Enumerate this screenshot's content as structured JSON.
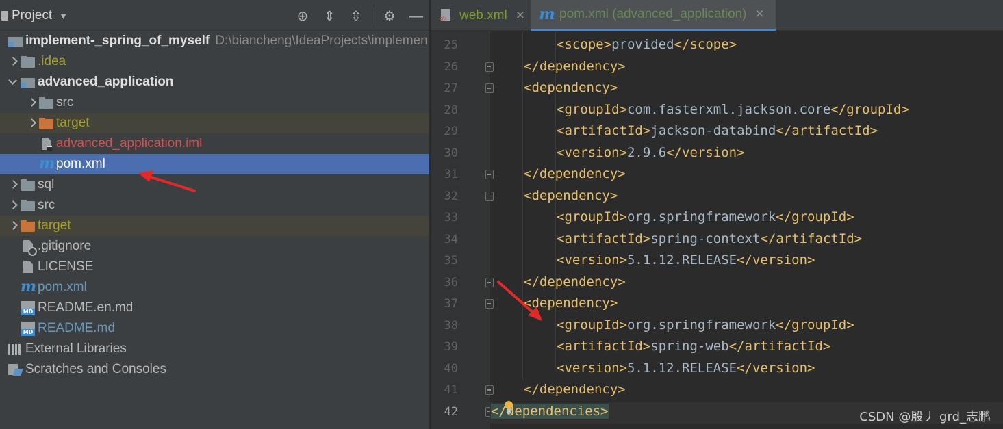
{
  "project_panel": {
    "title": "Project",
    "tree": [
      {
        "label": "implement-_spring_of_myself",
        "path": "D:\\biancheng\\IdeaProjects\\implemen",
        "icon": "module-icon",
        "arrow": "none",
        "indent": 0,
        "style": "c-bold",
        "state": ""
      },
      {
        "label": ".idea",
        "icon": "folder-icon",
        "arrow": "right",
        "indent": 1,
        "style": "c-olive",
        "state": ""
      },
      {
        "label": "advanced_application",
        "icon": "module-icon",
        "arrow": "down",
        "indent": 1,
        "style": "c-bold",
        "state": ""
      },
      {
        "label": "src",
        "icon": "folder-icon",
        "arrow": "right",
        "indent": 2,
        "style": "c-normal",
        "state": ""
      },
      {
        "label": "target",
        "icon": "folder-orange-icon",
        "arrow": "right",
        "indent": 2,
        "style": "c-olive",
        "state": "excluded"
      },
      {
        "label": "advanced_application.iml",
        "icon": "iml-file-icon",
        "arrow": "none",
        "indent": 2,
        "style": "c-red",
        "state": ""
      },
      {
        "label": "pom.xml",
        "icon": "maven-icon",
        "arrow": "none",
        "indent": 2,
        "style": "c-white",
        "state": "selected"
      },
      {
        "label": "sql",
        "icon": "folder-icon",
        "arrow": "right",
        "indent": 1,
        "style": "c-normal",
        "state": ""
      },
      {
        "label": "src",
        "icon": "folder-icon",
        "arrow": "right",
        "indent": 1,
        "style": "c-normal",
        "state": ""
      },
      {
        "label": "target",
        "icon": "folder-orange-icon",
        "arrow": "right",
        "indent": 1,
        "style": "c-olive",
        "state": "excluded"
      },
      {
        "label": ".gitignore",
        "icon": "gitignore-file-icon",
        "arrow": "none",
        "indent": 1,
        "style": "c-normal",
        "state": ""
      },
      {
        "label": "LICENSE",
        "icon": "file-icon",
        "arrow": "none",
        "indent": 1,
        "style": "c-normal",
        "state": ""
      },
      {
        "label": "pom.xml",
        "icon": "maven-icon",
        "arrow": "none",
        "indent": 1,
        "style": "c-blue",
        "state": ""
      },
      {
        "label": "README.en.md",
        "icon": "markdown-icon",
        "arrow": "none",
        "indent": 1,
        "style": "c-normal",
        "state": ""
      },
      {
        "label": "README.md",
        "icon": "markdown-icon",
        "arrow": "none",
        "indent": 1,
        "style": "c-blue",
        "state": ""
      },
      {
        "label": "External Libraries",
        "icon": "libraries-icon",
        "arrow": "none",
        "indent": 0,
        "style": "c-normal",
        "state": ""
      },
      {
        "label": "Scratches and Consoles",
        "icon": "scratches-icon",
        "arrow": "none",
        "indent": 0,
        "style": "c-normal",
        "state": ""
      }
    ]
  },
  "editor": {
    "tabs": [
      {
        "label": "web.xml",
        "active": false
      },
      {
        "label": "pom.xml (advanced_application)",
        "active": true
      }
    ],
    "current_line": 42,
    "lines": [
      {
        "n": 25,
        "level": 2,
        "parts": [
          [
            "tg",
            "<scope>"
          ],
          [
            "tx",
            "provided"
          ],
          [
            "tg",
            "</scope>"
          ]
        ],
        "fold": false
      },
      {
        "n": 26,
        "level": 1,
        "parts": [
          [
            "tg",
            "</dependency>"
          ]
        ],
        "fold": "end"
      },
      {
        "n": 27,
        "level": 1,
        "parts": [
          [
            "tg",
            "<dependency>"
          ]
        ],
        "fold": "start"
      },
      {
        "n": 28,
        "level": 2,
        "parts": [
          [
            "tg",
            "<groupId>"
          ],
          [
            "tx",
            "com.fasterxml.jackson.core"
          ],
          [
            "tg",
            "</groupId>"
          ]
        ],
        "fold": false
      },
      {
        "n": 29,
        "level": 2,
        "parts": [
          [
            "tg",
            "<artifactId>"
          ],
          [
            "tx",
            "jackson-databind"
          ],
          [
            "tg",
            "</artifactId>"
          ]
        ],
        "fold": false
      },
      {
        "n": 30,
        "level": 2,
        "parts": [
          [
            "tg",
            "<version>"
          ],
          [
            "tx",
            "2.9.6"
          ],
          [
            "tg",
            "</version>"
          ]
        ],
        "fold": false
      },
      {
        "n": 31,
        "level": 1,
        "parts": [
          [
            "tg",
            "</dependency>"
          ]
        ],
        "fold": "end"
      },
      {
        "n": 32,
        "level": 1,
        "parts": [
          [
            "tg",
            "<dependency>"
          ]
        ],
        "fold": "start"
      },
      {
        "n": 33,
        "level": 2,
        "parts": [
          [
            "tg",
            "<groupId>"
          ],
          [
            "tx",
            "org.springframework"
          ],
          [
            "tg",
            "</groupId>"
          ]
        ],
        "fold": false
      },
      {
        "n": 34,
        "level": 2,
        "parts": [
          [
            "tg",
            "<artifactId>"
          ],
          [
            "tx",
            "spring-context"
          ],
          [
            "tg",
            "</artifactId>"
          ]
        ],
        "fold": false
      },
      {
        "n": 35,
        "level": 2,
        "parts": [
          [
            "tg",
            "<version>"
          ],
          [
            "tx",
            "5.1.12.RELEASE"
          ],
          [
            "tg",
            "</version>"
          ]
        ],
        "fold": false
      },
      {
        "n": 36,
        "level": 1,
        "parts": [
          [
            "tg",
            "</dependency>"
          ]
        ],
        "fold": "end"
      },
      {
        "n": 37,
        "level": 1,
        "parts": [
          [
            "tg",
            "<dependency>"
          ]
        ],
        "fold": "start"
      },
      {
        "n": 38,
        "level": 2,
        "parts": [
          [
            "tg",
            "<groupId>"
          ],
          [
            "tx",
            "org.springframework"
          ],
          [
            "tg",
            "</groupId>"
          ]
        ],
        "fold": false
      },
      {
        "n": 39,
        "level": 2,
        "parts": [
          [
            "tg",
            "<artifactId>"
          ],
          [
            "tx",
            "spring-web"
          ],
          [
            "tg",
            "</artifactId>"
          ]
        ],
        "fold": false
      },
      {
        "n": 40,
        "level": 2,
        "parts": [
          [
            "tg",
            "<version>"
          ],
          [
            "tx",
            "5.1.12.RELEASE"
          ],
          [
            "tg",
            "</version>"
          ]
        ],
        "fold": false
      },
      {
        "n": 41,
        "level": 1,
        "parts": [
          [
            "tg",
            "</dependency>"
          ]
        ],
        "fold": "end"
      },
      {
        "n": 42,
        "level": 0,
        "parts": [
          [
            "tg hl-tag",
            "</dependencies>"
          ]
        ],
        "fold": "end"
      }
    ]
  },
  "watermark": "CSDN @殷丿 grd_志鹏",
  "colors": {
    "accent": "#4b6eaf",
    "tag": "#e8bf6a",
    "text": "#a9b7c6",
    "annotation_arrow": "#e02a2a"
  }
}
